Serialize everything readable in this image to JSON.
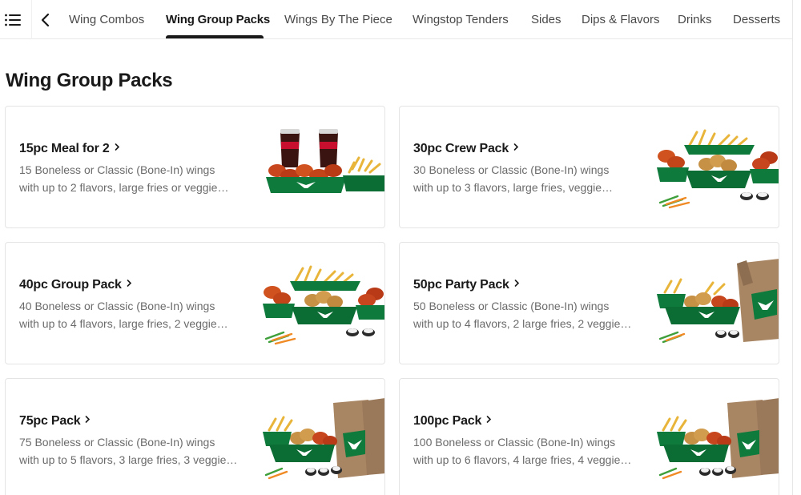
{
  "nav": {
    "tabs": [
      {
        "label": "Wing Combos"
      },
      {
        "label": "Wing Group Packs"
      },
      {
        "label": "Wings By The Piece"
      },
      {
        "label": "Wingstop Tenders"
      },
      {
        "label": "Sides"
      },
      {
        "label": "Dips & Flavors"
      },
      {
        "label": "Drinks"
      },
      {
        "label": "Desserts"
      }
    ],
    "active_tab": "Wing Group Packs"
  },
  "section": {
    "title": "Wing Group Packs"
  },
  "items": [
    {
      "title": "15pc Meal for 2",
      "desc_line1": "15 Boneless or Classic (Bone-In) wings",
      "desc_line2": "with up to 2 flavors, large fries or veggie…",
      "image": "wings-with-cola-cups-photo"
    },
    {
      "title": "30pc Crew Pack",
      "desc_line1": "30 Boneless or Classic (Bone-In) wings",
      "desc_line2": "with up to 3 flavors, large fries, veggie…",
      "image": "wings-trays-with-fries-photo"
    },
    {
      "title": "40pc Group Pack",
      "desc_line1": "40 Boneless or Classic (Bone-In) wings",
      "desc_line2": "with up to 4 flavors, large fries, 2 veggie…",
      "image": "wings-trays-with-fries-photo"
    },
    {
      "title": "50pc Party Pack",
      "desc_line1": "50 Boneless or Classic (Bone-In) wings",
      "desc_line2": "with up to 4 flavors, 2 large fries, 2 veggie…",
      "image": "wings-trays-with-paper-bag-photo"
    },
    {
      "title": "75pc Pack",
      "desc_line1": "75 Boneless or Classic (Bone-In) wings",
      "desc_line2": "with up to 5 flavors, 3 large fries, 3 veggie…",
      "image": "wings-trays-with-two-bags-photo"
    },
    {
      "title": "100pc Pack",
      "desc_line1": "100 Boneless or Classic (Bone-In) wings",
      "desc_line2": "with up to 6 flavors, 4 large fries, 4 veggie…",
      "image": "wings-trays-with-two-bags-photo"
    }
  ],
  "colors": {
    "text_primary": "#191919",
    "text_secondary": "#6b6b6b",
    "brand_green": "#0e7a3c",
    "card_border": "#e4e4e4"
  }
}
